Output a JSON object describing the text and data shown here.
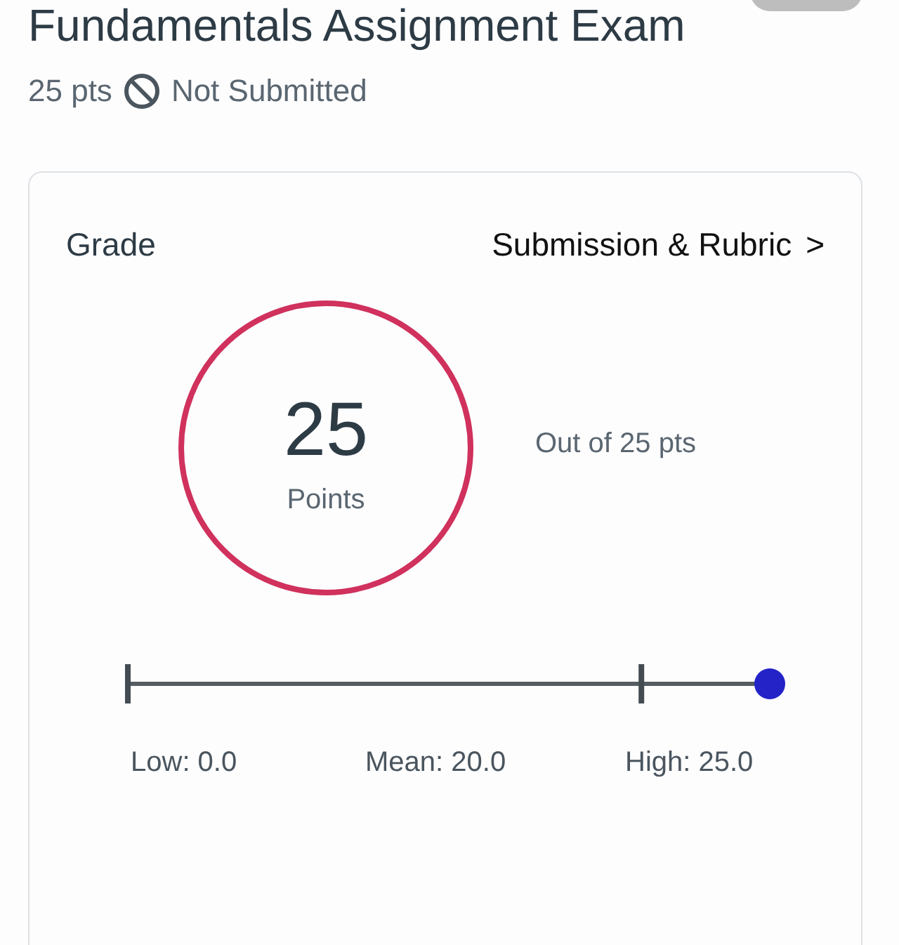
{
  "title": "Fundamentals Assignment Exam",
  "meta": {
    "points": "25 pts",
    "status": "Not Submitted"
  },
  "grade_card": {
    "heading": "Grade",
    "link": "Submission & Rubric",
    "chevron": ">",
    "score": {
      "value": "25",
      "unit": "Points",
      "out_of": "Out of 25 pts"
    },
    "range": {
      "mean_marker": {
        "level": 0.8
      },
      "score_marker": {
        "level": 1
      },
      "labels": [
        {
          "kind": "low",
          "text": "Low: 0.0"
        },
        {
          "kind": "mean",
          "text": "Mean: 20.0"
        },
        {
          "kind": "high",
          "text": "High: 25.0"
        }
      ]
    }
  }
}
